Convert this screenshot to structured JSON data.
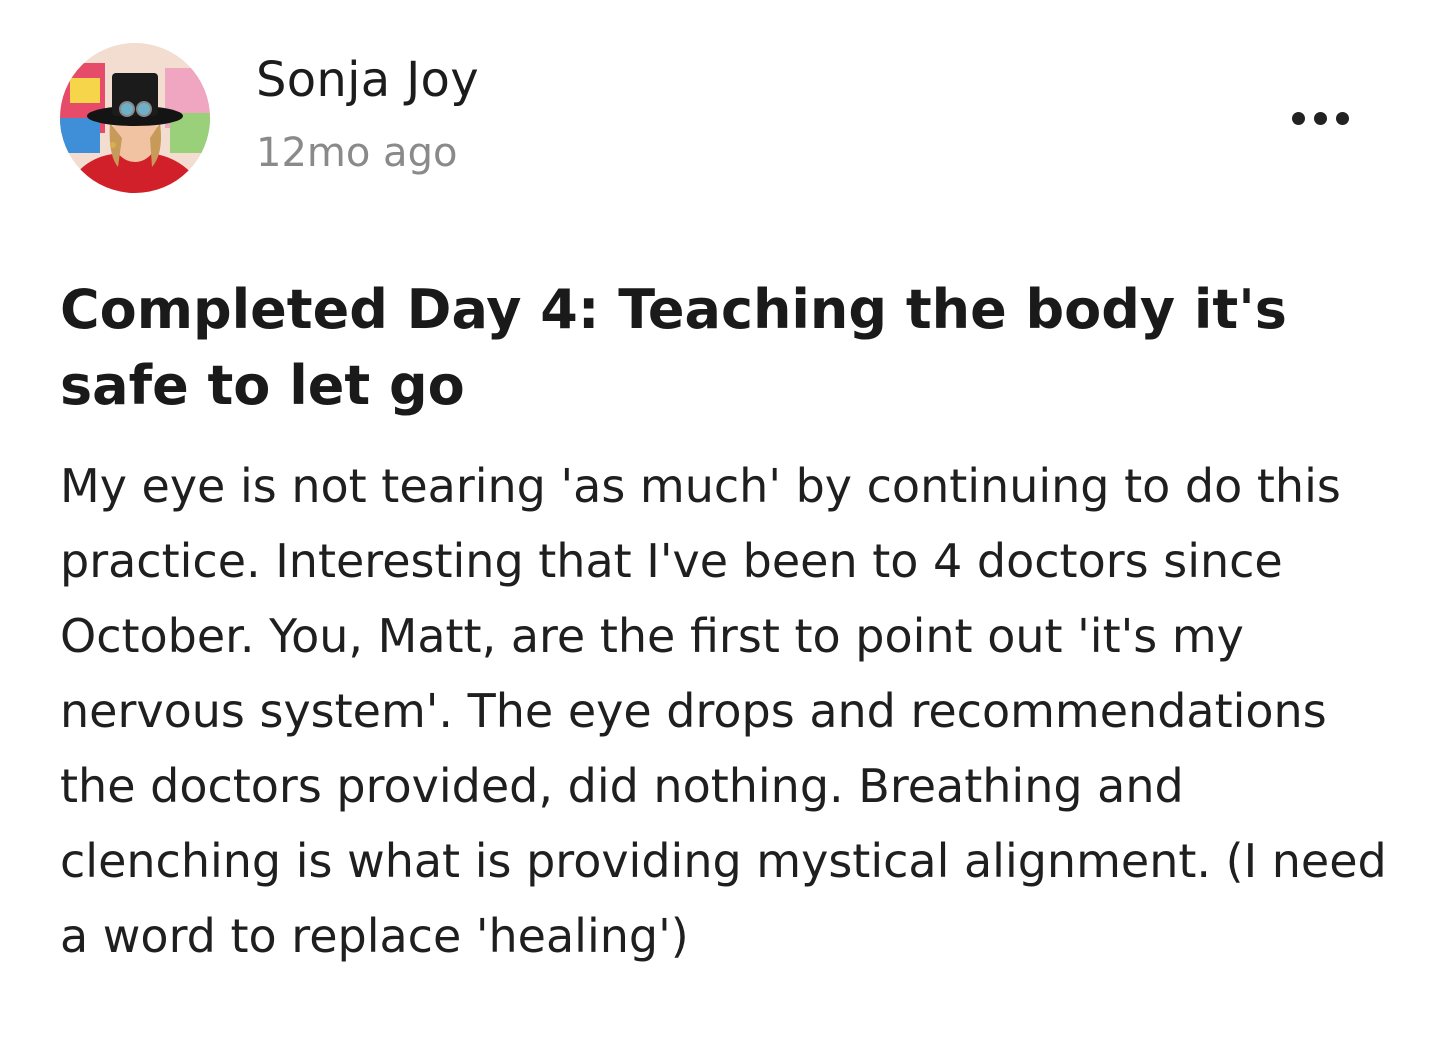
{
  "post": {
    "author": {
      "name": "Sonja Joy",
      "avatar_alt": "Sonja Joy avatar"
    },
    "timestamp": "12mo ago",
    "more_icon": "more-horizontal-icon",
    "title": "Completed Day 4: Teaching the body it's safe to let go",
    "body": "My eye is not tearing 'as much' by continuing to do this practice. Interesting that I've been to 4 doctors since October. You, Matt, are the first to point out 'it's my nervous system'. The eye drops and recommendations the doctors provided, did nothing. Breathing and clenching is what is providing mystical alignment. (I need a word to replace 'healing')"
  },
  "colors": {
    "text": "#1a1a1a",
    "muted": "#8a8a8a",
    "background": "#ffffff"
  }
}
